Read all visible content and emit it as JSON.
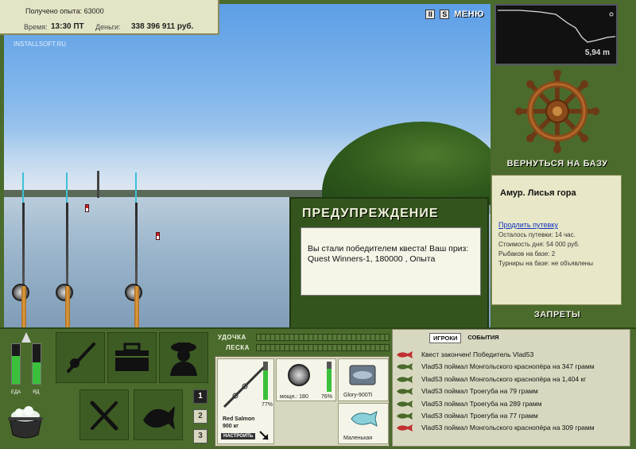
{
  "stats": {
    "experience": "Получено опыта: 63000",
    "time_label": "Время:",
    "time_value": "13:30 ПТ",
    "money_label": "Деньги:",
    "money_value": "338 396 911 руб.",
    "watermark": "INSTALLSOFT.RU"
  },
  "header": {
    "pause_label": "II",
    "save_label": "S",
    "menu_label": "МЕНЮ"
  },
  "depth": {
    "value": "5,94 m"
  },
  "base": {
    "return_label": "ВЕРНУТЬСЯ НА БАЗУ",
    "location_name": "Амур. Лисья гора",
    "extend_link": "Продлить путевку",
    "lines": [
      "Осталось путевки: 14 час.",
      "Стоимость дня: 54 000 руб.",
      "Рыбаков на базе: 2",
      "Турниры на базе: не объявлены"
    ],
    "bans_label": "ЗАПРЕТЫ"
  },
  "dialog": {
    "title": "ПРЕДУПРЕЖДЕНИЕ",
    "message": "Вы стали победителем квеста! Ваш приз: Quest Winners-1, 180000 , Опыта"
  },
  "gauges": {
    "food_label": "ЕДА",
    "poison_label": "ЯД",
    "food_level": 0.7,
    "poison_level": 0.55
  },
  "slots": [
    "1",
    "2",
    "3"
  ],
  "rod_bars": {
    "rod_label": "УДОЧКА",
    "line_label": "ЛЕСКА"
  },
  "tackle": {
    "rod_name": "Red Salmon",
    "rod_weight": "900 кг",
    "rod_wear": "77%",
    "reel_power": "мощн.: 180",
    "reel_wear": "76%",
    "lure_name": "Glory-900Ti",
    "bait_name": "Маленькая",
    "adjust_label": "НАСТРОИТЬ"
  },
  "events": {
    "tabs": [
      "ИГРОКИ",
      "СОБЫТИЯ"
    ],
    "items": [
      "Квест закончен! Победитель Vlad53",
      "Vlad53 поймал Монгольского краснопёра на 347 грамм",
      "Vlad53 поймал Монгольского краснопёра на 1,404 кг",
      "Vlad53 поймал Троегуба на 79 грамм",
      "Vlad53 поймал Троегуба на 289 грамм",
      "Vlad53 поймал Троегуба на 77 грамм",
      "Vlad53 поймал Монгольского краснопёра на 309 грамм"
    ]
  },
  "colors": {
    "panel_green": "#4a6b2c",
    "dialog_green": "#34541e",
    "cream": "#e8e8c8",
    "link_blue": "#1030c0"
  }
}
